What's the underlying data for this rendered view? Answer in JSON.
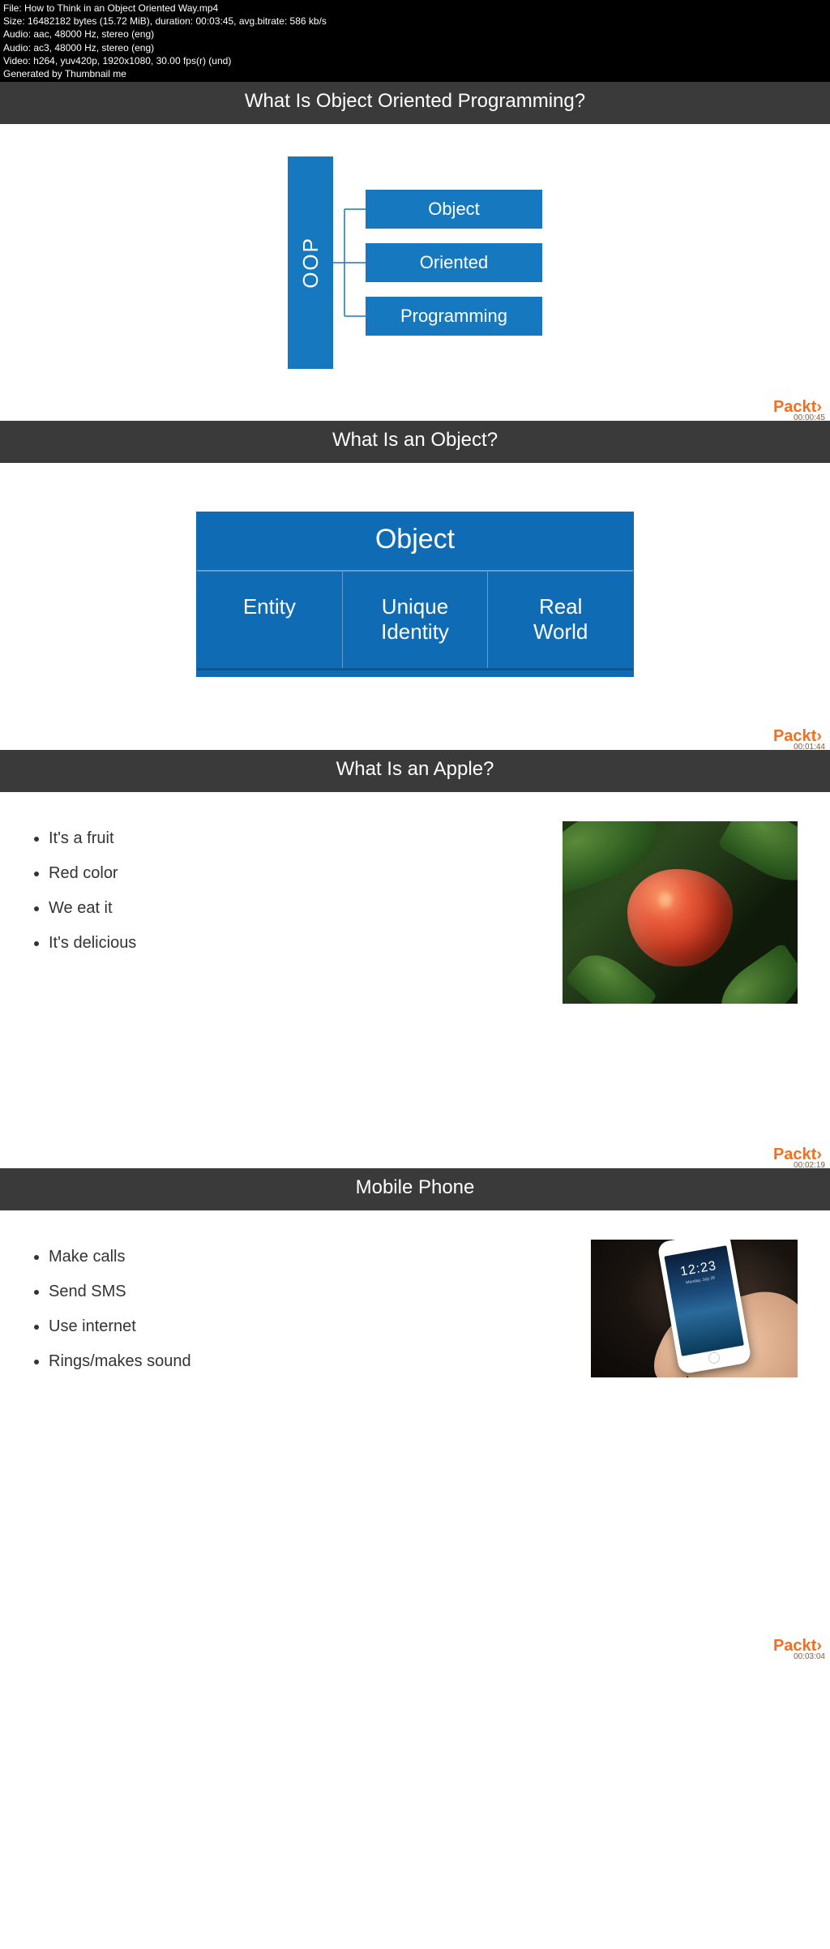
{
  "meta": {
    "file": "File: How to Think in an Object Oriented Way.mp4",
    "size": "Size: 16482182 bytes (15.72 MiB), duration: 00:03:45, avg.bitrate: 586 kb/s",
    "audio1": "Audio: aac, 48000 Hz, stereo (eng)",
    "audio2": "Audio: ac3, 48000 Hz, stereo (eng)",
    "video": "Video: h264, yuv420p, 1920x1080, 30.00 fps(r) (und)",
    "gen": "Generated by Thumbnail me"
  },
  "brand": "Packt›",
  "slide1": {
    "title": "What Is Object Oriented Programming?",
    "vertical": "OOP",
    "items": [
      "Object",
      "Oriented",
      "Programming"
    ],
    "timestamp": "00:00:45"
  },
  "slide2": {
    "title": "What Is an Object?",
    "header": "Object",
    "cells": [
      "Entity",
      "Unique\nIdentity",
      "Real\nWorld"
    ],
    "timestamp": "00:01:44"
  },
  "slide3": {
    "title": "What Is an Apple?",
    "bullets": [
      "It's a fruit",
      "Red color",
      "We eat it",
      "It's delicious"
    ],
    "timestamp": "00:02:19"
  },
  "slide4": {
    "title": "Mobile Phone",
    "bullets": [
      "Make calls",
      "Send SMS",
      "Use internet",
      "Rings/makes sound"
    ],
    "phone_time": "12:23",
    "phone_date": "Monday, July 28",
    "timestamp": "00:03:04"
  }
}
